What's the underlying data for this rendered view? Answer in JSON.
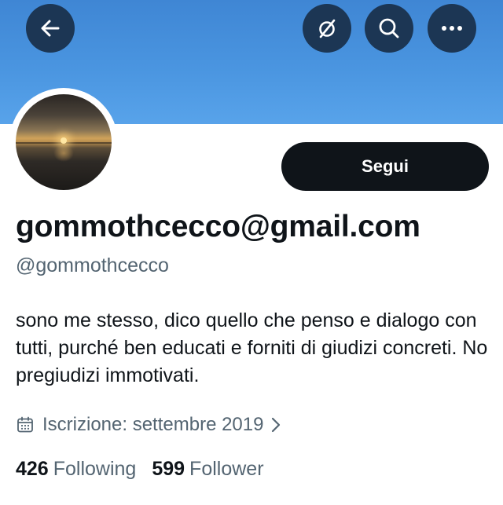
{
  "header": {
    "back_icon": "arrow-left-icon",
    "feed_icon": "slashed-circle-icon",
    "search_icon": "search-icon",
    "more_icon": "more-dots-icon",
    "button_color": "#1c3654",
    "banner_color": "#4a95e0"
  },
  "profile": {
    "display_name": "gommothcecco@gmail.com",
    "handle": "@gommothcecco",
    "bio": "sono me stesso, dico quello che penso e dialogo con tutti, purché ben educati e forniti di giudizi concreti. No pregiudizi immotivati.",
    "follow_label": "Segui",
    "joined": "Iscrizione: settembre 2019"
  },
  "stats": {
    "following_count": "426",
    "following_label": "Following",
    "followers_count": "599",
    "followers_label": "Follower"
  }
}
